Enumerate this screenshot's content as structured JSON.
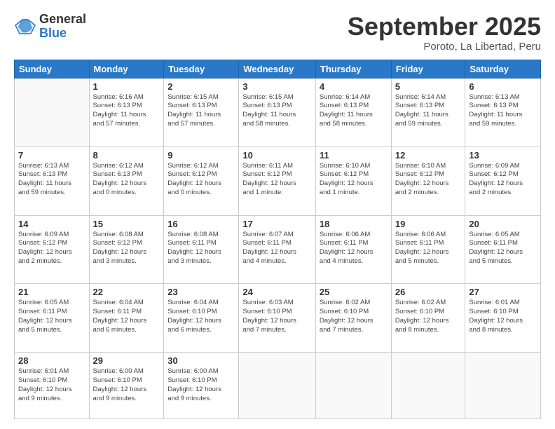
{
  "logo": {
    "general": "General",
    "blue": "Blue"
  },
  "header": {
    "month": "September 2025",
    "location": "Poroto, La Libertad, Peru"
  },
  "days_of_week": [
    "Sunday",
    "Monday",
    "Tuesday",
    "Wednesday",
    "Thursday",
    "Friday",
    "Saturday"
  ],
  "weeks": [
    [
      {
        "day": "",
        "info": ""
      },
      {
        "day": "1",
        "info": "Sunrise: 6:16 AM\nSunset: 6:13 PM\nDaylight: 11 hours\nand 57 minutes."
      },
      {
        "day": "2",
        "info": "Sunrise: 6:15 AM\nSunset: 6:13 PM\nDaylight: 11 hours\nand 57 minutes."
      },
      {
        "day": "3",
        "info": "Sunrise: 6:15 AM\nSunset: 6:13 PM\nDaylight: 11 hours\nand 58 minutes."
      },
      {
        "day": "4",
        "info": "Sunrise: 6:14 AM\nSunset: 6:13 PM\nDaylight: 11 hours\nand 58 minutes."
      },
      {
        "day": "5",
        "info": "Sunrise: 6:14 AM\nSunset: 6:13 PM\nDaylight: 11 hours\nand 59 minutes."
      },
      {
        "day": "6",
        "info": "Sunrise: 6:13 AM\nSunset: 6:13 PM\nDaylight: 11 hours\nand 59 minutes."
      }
    ],
    [
      {
        "day": "7",
        "info": "Sunrise: 6:13 AM\nSunset: 6:13 PM\nDaylight: 11 hours\nand 59 minutes."
      },
      {
        "day": "8",
        "info": "Sunrise: 6:12 AM\nSunset: 6:13 PM\nDaylight: 12 hours\nand 0 minutes."
      },
      {
        "day": "9",
        "info": "Sunrise: 6:12 AM\nSunset: 6:12 PM\nDaylight: 12 hours\nand 0 minutes."
      },
      {
        "day": "10",
        "info": "Sunrise: 6:11 AM\nSunset: 6:12 PM\nDaylight: 12 hours\nand 1 minute."
      },
      {
        "day": "11",
        "info": "Sunrise: 6:10 AM\nSunset: 6:12 PM\nDaylight: 12 hours\nand 1 minute."
      },
      {
        "day": "12",
        "info": "Sunrise: 6:10 AM\nSunset: 6:12 PM\nDaylight: 12 hours\nand 2 minutes."
      },
      {
        "day": "13",
        "info": "Sunrise: 6:09 AM\nSunset: 6:12 PM\nDaylight: 12 hours\nand 2 minutes."
      }
    ],
    [
      {
        "day": "14",
        "info": "Sunrise: 6:09 AM\nSunset: 6:12 PM\nDaylight: 12 hours\nand 2 minutes."
      },
      {
        "day": "15",
        "info": "Sunrise: 6:08 AM\nSunset: 6:12 PM\nDaylight: 12 hours\nand 3 minutes."
      },
      {
        "day": "16",
        "info": "Sunrise: 6:08 AM\nSunset: 6:11 PM\nDaylight: 12 hours\nand 3 minutes."
      },
      {
        "day": "17",
        "info": "Sunrise: 6:07 AM\nSunset: 6:11 PM\nDaylight: 12 hours\nand 4 minutes."
      },
      {
        "day": "18",
        "info": "Sunrise: 6:06 AM\nSunset: 6:11 PM\nDaylight: 12 hours\nand 4 minutes."
      },
      {
        "day": "19",
        "info": "Sunrise: 6:06 AM\nSunset: 6:11 PM\nDaylight: 12 hours\nand 5 minutes."
      },
      {
        "day": "20",
        "info": "Sunrise: 6:05 AM\nSunset: 6:11 PM\nDaylight: 12 hours\nand 5 minutes."
      }
    ],
    [
      {
        "day": "21",
        "info": "Sunrise: 6:05 AM\nSunset: 6:11 PM\nDaylight: 12 hours\nand 5 minutes."
      },
      {
        "day": "22",
        "info": "Sunrise: 6:04 AM\nSunset: 6:11 PM\nDaylight: 12 hours\nand 6 minutes."
      },
      {
        "day": "23",
        "info": "Sunrise: 6:04 AM\nSunset: 6:10 PM\nDaylight: 12 hours\nand 6 minutes."
      },
      {
        "day": "24",
        "info": "Sunrise: 6:03 AM\nSunset: 6:10 PM\nDaylight: 12 hours\nand 7 minutes."
      },
      {
        "day": "25",
        "info": "Sunrise: 6:02 AM\nSunset: 6:10 PM\nDaylight: 12 hours\nand 7 minutes."
      },
      {
        "day": "26",
        "info": "Sunrise: 6:02 AM\nSunset: 6:10 PM\nDaylight: 12 hours\nand 8 minutes."
      },
      {
        "day": "27",
        "info": "Sunrise: 6:01 AM\nSunset: 6:10 PM\nDaylight: 12 hours\nand 8 minutes."
      }
    ],
    [
      {
        "day": "28",
        "info": "Sunrise: 6:01 AM\nSunset: 6:10 PM\nDaylight: 12 hours\nand 9 minutes."
      },
      {
        "day": "29",
        "info": "Sunrise: 6:00 AM\nSunset: 6:10 PM\nDaylight: 12 hours\nand 9 minutes."
      },
      {
        "day": "30",
        "info": "Sunrise: 6:00 AM\nSunset: 6:10 PM\nDaylight: 12 hours\nand 9 minutes."
      },
      {
        "day": "",
        "info": ""
      },
      {
        "day": "",
        "info": ""
      },
      {
        "day": "",
        "info": ""
      },
      {
        "day": "",
        "info": ""
      }
    ]
  ]
}
